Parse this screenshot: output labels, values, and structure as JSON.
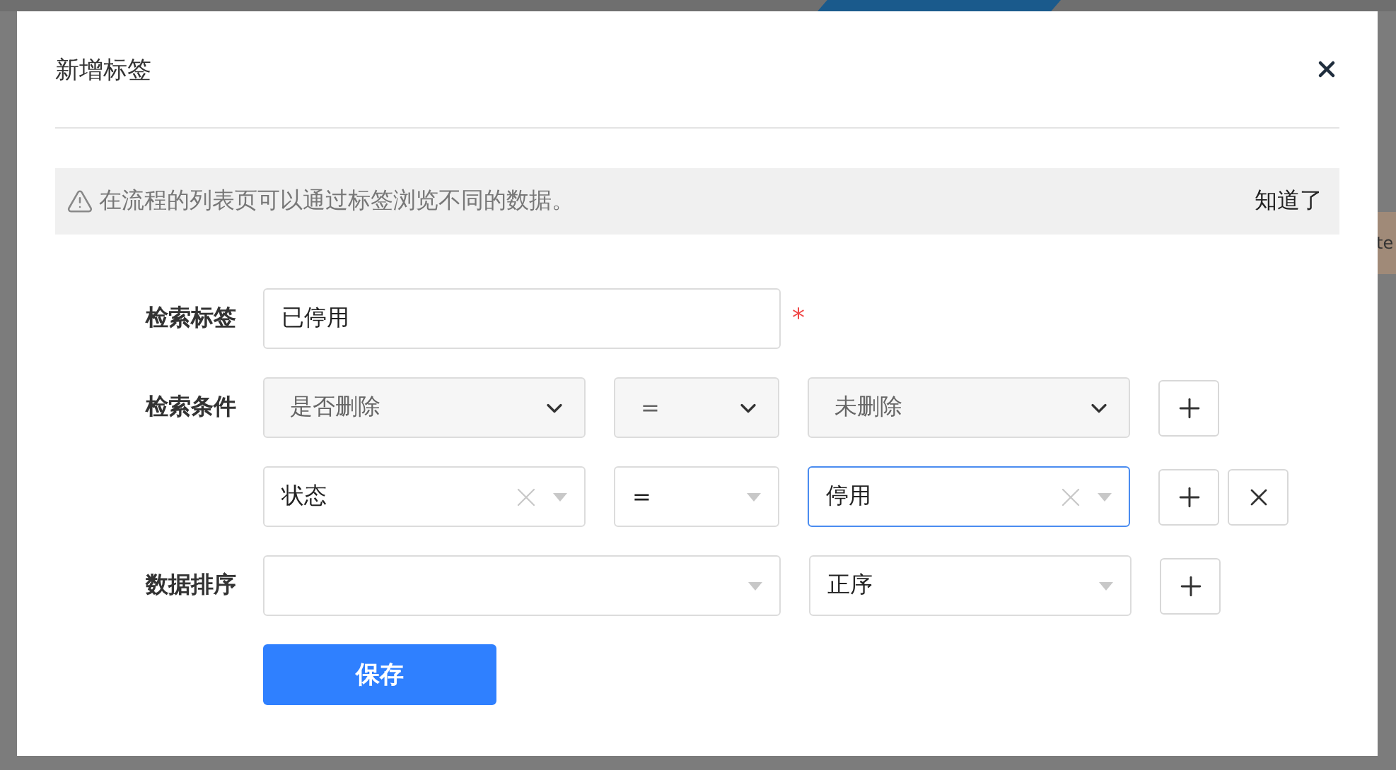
{
  "background": {
    "edge_text": "te"
  },
  "dialog": {
    "title": "新增标签",
    "notice": {
      "text": "在流程的列表页可以通过标签浏览不同的数据。",
      "dismiss": "知道了"
    },
    "form": {
      "name": {
        "label": "检索标签",
        "value": "已停用",
        "required": true,
        "required_mark": "*"
      },
      "conditions_label": "检索条件",
      "conditions": [
        {
          "kind": "native",
          "field": "是否删除",
          "operator": "=",
          "value": "未删除",
          "focused": false,
          "removable": false
        },
        {
          "kind": "clearable",
          "field": "状态",
          "operator": "=",
          "value": "停用",
          "focused": true,
          "removable": true
        }
      ],
      "sort": {
        "label": "数据排序",
        "order": "正序"
      },
      "submit": "保存"
    }
  }
}
